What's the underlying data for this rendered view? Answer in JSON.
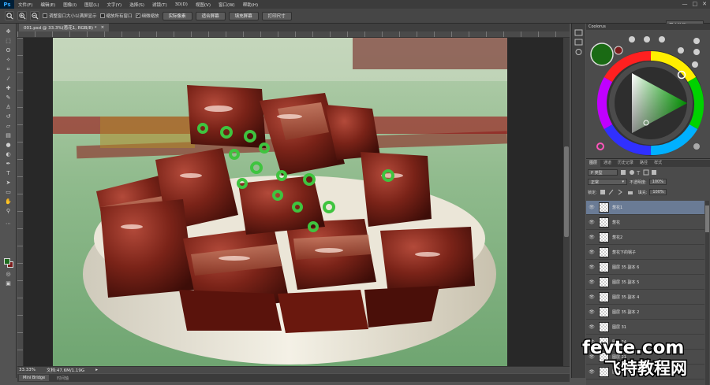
{
  "menubar": {
    "logo": "Ps",
    "items": [
      "文件(F)",
      "编辑(E)",
      "图像(I)",
      "图层(L)",
      "文字(Y)",
      "选择(S)",
      "滤镜(T)",
      "3D(D)",
      "视图(V)",
      "窗口(W)",
      "帮助(H)"
    ],
    "window_controls": [
      "—",
      "□",
      "✕"
    ]
  },
  "options_bar": {
    "checkbox_1": "调整窗口大小以满屏显示",
    "checkbox_2": "缩放所有窗口",
    "checkbox_3": "细微缩放",
    "checkbox_3_checked": "✓",
    "btn_actual": "实际像素",
    "btn_fit": "适合屏幕",
    "btn_fill": "填充屏幕",
    "btn_print": "打印尺寸",
    "workspace": "基本功能",
    "workspace_arrow": "▾"
  },
  "document": {
    "tab_title": "001.psd @ 33.3%(葱花1, RGB/8) *",
    "tab_close": "×",
    "zoom": "33.33%",
    "doc_size": "文档:47.6M/1.19G",
    "statusbar_arrow": "▸"
  },
  "minibridge": {
    "tab_active": "Mini Bridge",
    "tab_inactive": "时间轴"
  },
  "color_panel": {
    "tab": "Coolorus",
    "fg_color": "#1f6b1f",
    "bg_color": "#7a1c1c"
  },
  "layers_panel": {
    "tabs": [
      "图层",
      "通道",
      "历史记录",
      "路径",
      "样式"
    ],
    "filter_label": "P 类型",
    "blend_mode": "正常",
    "opacity_label": "不透明度:",
    "opacity_value": "100%",
    "lock_label": "锁定:",
    "fill_label": "填充:",
    "fill_value": "100%",
    "eye": "👁",
    "layers": [
      {
        "name": "葱花1",
        "selected": true
      },
      {
        "name": "葱花"
      },
      {
        "name": "葱花2"
      },
      {
        "name": "葱花下的锅子"
      },
      {
        "name": "图层 35 副本 6"
      },
      {
        "name": "图层 35 副本 5"
      },
      {
        "name": "图层 35 副本 4"
      },
      {
        "name": "图层 35 副本 2"
      },
      {
        "name": "图层 31"
      },
      {
        "name": "图层 24"
      },
      {
        "name": "图层 21"
      },
      {
        "name": "图层 6"
      }
    ]
  },
  "watermark": {
    "line1": "fevte.com",
    "line2": "飞特教程网"
  }
}
